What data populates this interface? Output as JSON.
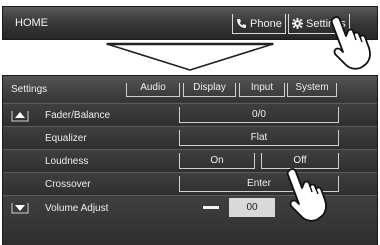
{
  "home_bar": {
    "title": "HOME",
    "phone_label": "Phone",
    "settings_label": "Settings"
  },
  "settings_panel": {
    "title": "Settings",
    "tabs": [
      {
        "label": "Audio"
      },
      {
        "label": "Display"
      },
      {
        "label": "Input"
      },
      {
        "label": "System"
      }
    ],
    "rows": [
      {
        "label": "Fader/Balance",
        "value": "0/0"
      },
      {
        "label": "Equalizer",
        "value": "Flat"
      },
      {
        "label": "Loudness",
        "options": [
          "On",
          "Off"
        ]
      },
      {
        "label": "Crossover",
        "value": "Enter"
      },
      {
        "label": "Volume Adjust",
        "value": "00"
      }
    ]
  },
  "icons": [
    "phone-icon",
    "gear-icon",
    "scroll-up-icon",
    "scroll-down-icon",
    "down-arrow-icon",
    "pointing-hand-icon",
    "minus-icon"
  ]
}
